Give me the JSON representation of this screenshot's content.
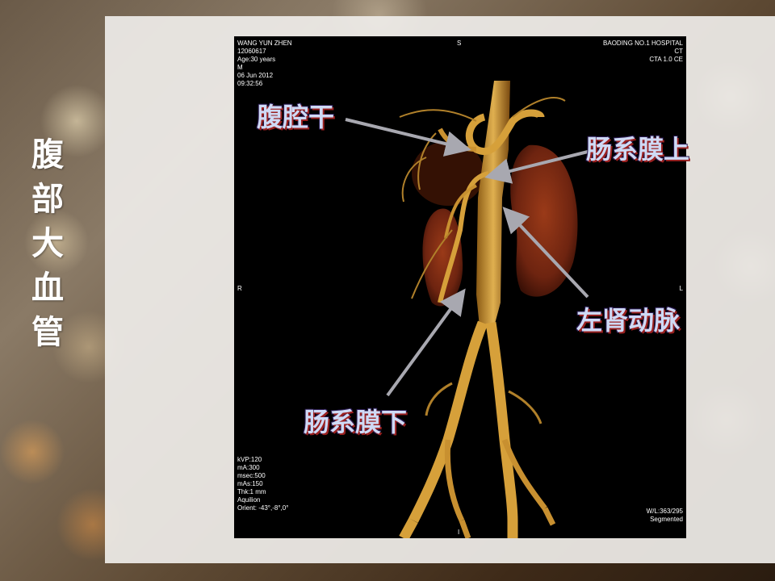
{
  "slide_title": "腹部大血管",
  "ct_meta": {
    "top_left": [
      "WANG YUN ZHEN",
      "12060617",
      "Age:30 years",
      "M",
      "06 Jun 2012",
      "09:32:56"
    ],
    "top_center": "S",
    "top_right": [
      "BAODING NO.1 HOSPITAL",
      "CT",
      "CTA 1.0 CE"
    ],
    "mid_left": "R",
    "mid_right": "L",
    "bottom_left": [
      "kVP:120",
      "mA:300",
      "msec:500",
      "mAs:150",
      "Thk:1 mm",
      "Aquilion",
      "Orient: -43°,-8°,0°"
    ],
    "bottom_right": [
      "W/L:363/295",
      "Segmented"
    ],
    "bottom_center": "I"
  },
  "labels": {
    "celiac": "腹腔干",
    "sma": "肠系膜上",
    "left_renal": "左肾动脉",
    "ima": "肠系膜下"
  },
  "colors": {
    "label_fill": "#cfdaf5",
    "label_shadow": "#9a2020",
    "arrow": "#a8a8b0",
    "vessel": "#d9a73e",
    "kidney": "#7a2a10"
  }
}
